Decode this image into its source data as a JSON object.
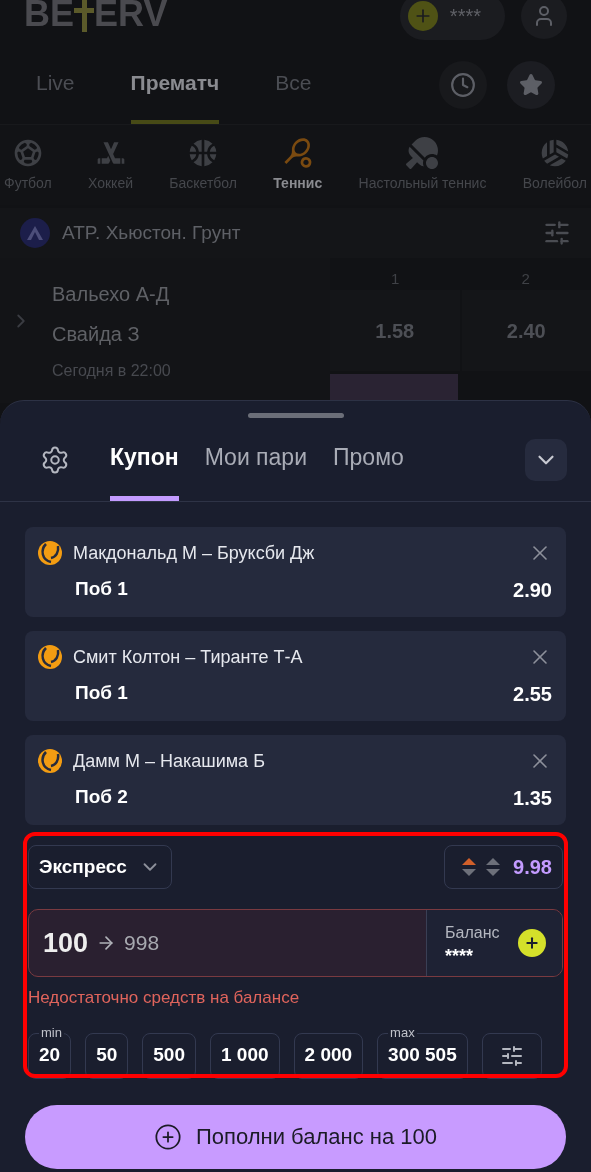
{
  "header": {
    "logo_left": "BE",
    "logo_right": "ERV",
    "balance": "****"
  },
  "top_tabs": [
    {
      "label": "Live",
      "selected": false
    },
    {
      "label": "Прематч",
      "selected": true
    },
    {
      "label": "Все",
      "selected": false
    }
  ],
  "sports": [
    {
      "label": "Футбол",
      "selected": false
    },
    {
      "label": "Хоккей",
      "selected": false
    },
    {
      "label": "Баскетбол",
      "selected": false
    },
    {
      "label": "Теннис",
      "selected": true
    },
    {
      "label": "Настольный теннис",
      "selected": false
    },
    {
      "label": "Волейбол",
      "selected": false
    }
  ],
  "league": {
    "title": "ATP. Хьюстон. Грунт"
  },
  "match": {
    "team_1": "Вальехо А-Д",
    "team_2": "Свайда З",
    "time": "Сегодня в 22:00",
    "columns": [
      "1",
      "2"
    ],
    "odds": [
      "1.58",
      "2.40"
    ]
  },
  "coupon": {
    "tabs": [
      {
        "label": "Купон",
        "selected": true
      },
      {
        "label": "Мои пари",
        "selected": false
      },
      {
        "label": "Промо",
        "selected": false
      }
    ],
    "bets": [
      {
        "event": "Макдональд М – Бруксби Дж",
        "outcome": "Поб 1",
        "odds": "2.90"
      },
      {
        "event": "Смит Колтон – Тиранте Т-А",
        "outcome": "Поб 1",
        "odds": "2.55"
      },
      {
        "event": "Дамм М – Накашима Б",
        "outcome": "Поб 2",
        "odds": "1.35"
      }
    ],
    "bet_type": "Экспресс",
    "total_odds": "9.98",
    "stake": {
      "value": "100",
      "payout": "998",
      "error": true
    },
    "balance_label": "Баланс",
    "balance": "****",
    "error": "Недостаточно средств на балансе",
    "amounts": [
      {
        "value": "20",
        "tag": "min"
      },
      {
        "value": "50"
      },
      {
        "value": "500"
      },
      {
        "value": "1 000"
      },
      {
        "value": "2 000"
      },
      {
        "value": "300 505",
        "tag": "max"
      }
    ],
    "submit": "Пополни баланс на 100"
  },
  "highlight": {
    "visible": true
  }
}
